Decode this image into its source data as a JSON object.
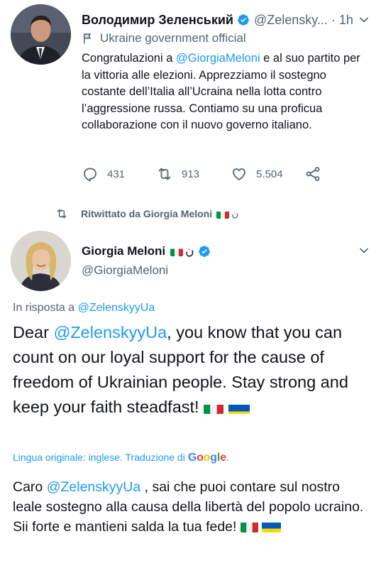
{
  "tweet1": {
    "display_name": "Володимир Зеленський",
    "handle": "@Zelensky...",
    "separator": "·",
    "time": "1h",
    "label": "Ukraine government official",
    "text_before": "Congratulazioni a ",
    "mention": "@GiorgiaMeloni",
    "text_after": " e al suo partito per la vittoria alle elezioni. Apprezziamo il sostegno costante dell’Italia all’Ucraina nella lotta contro l’aggressione russa. Contiamo su una proficua collaborazione con il nuovo governo italiano.",
    "replies": "431",
    "retweets": "913",
    "likes": "5.504"
  },
  "retweet_label": "Ritwittato da Giorgia Meloni",
  "retweet_suffix": "ن",
  "tweet2": {
    "display_name": "Giorgia Meloni",
    "name_suffix": "ن",
    "handle": "@GiorgiaMeloni",
    "reply_prefix": "In risposta a ",
    "reply_handle": "@ZelenskyyUa",
    "text_before": "Dear ",
    "mention": "@ZelenskyyUa",
    "text_after": ", you know that you can count on our loyal support for the cause of freedom of Ukrainian people. Stay strong and keep your faith steadfast! ",
    "original_language": "Lingua originale: inglese. Traduzione di",
    "translator": "Google",
    "translator_suffix": ".",
    "translation_before": "Caro ",
    "translation_mention": "@ZelenskyyUa",
    "translation_after": " , sai che puoi contare sul nostro leale sostegno alla causa della libertà del popolo ucraino. Sii forte e mantieni salda la tua fede! "
  },
  "icons": {
    "verified": "verified-badge-icon",
    "government": "flag-icon",
    "reply": "reply-icon",
    "retweet": "retweet-icon",
    "like": "heart-icon",
    "share": "share-icon",
    "more": "more-icon"
  },
  "colors": {
    "accent": "#1d9bf0",
    "muted": "#536471",
    "text": "#0f1419"
  }
}
